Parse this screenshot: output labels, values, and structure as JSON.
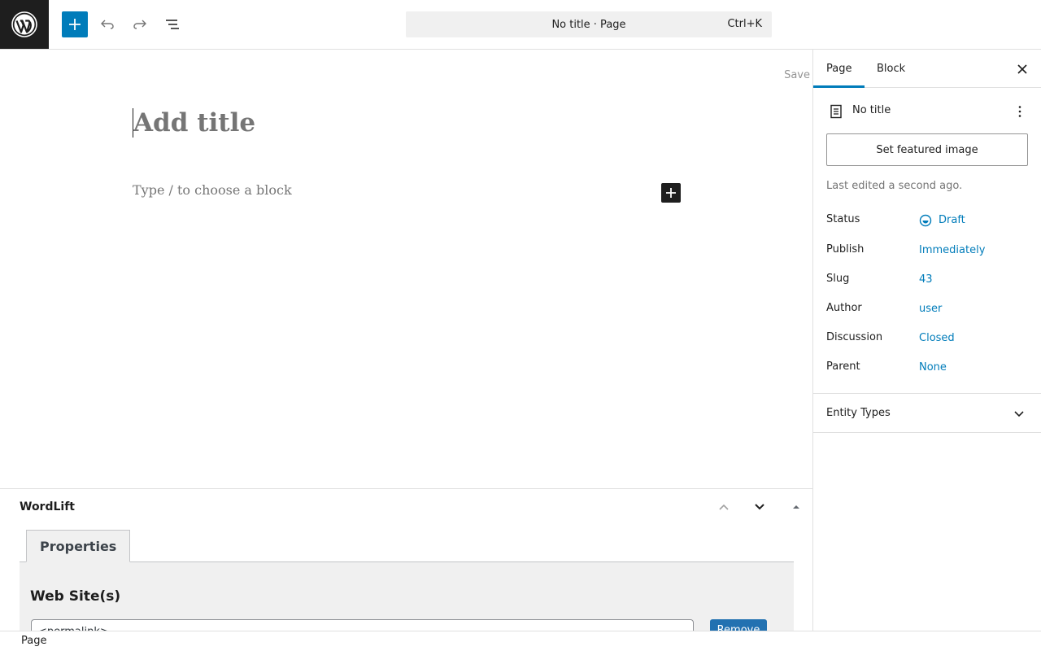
{
  "topbar": {
    "command_bar_label": "No title · Page",
    "command_bar_shortcut": "Ctrl+K"
  },
  "editor": {
    "save_label": "Save",
    "title_placeholder": "Add title",
    "block_placeholder": "Type / to choose a block"
  },
  "metabox": {
    "title": "WordLift",
    "tab_label": "Properties",
    "section_heading": "Web Site(s)",
    "input_value": "<permalink>",
    "remove_label": "Remove"
  },
  "footer": {
    "breadcrumb": "Page"
  },
  "sidebar": {
    "tabs": [
      {
        "label": "Page"
      },
      {
        "label": "Block"
      }
    ],
    "doc_title": "No title",
    "featured_image_label": "Set featured image",
    "last_edited": "Last edited a second ago.",
    "rows": [
      {
        "label": "Status",
        "value": "Draft"
      },
      {
        "label": "Publish",
        "value": "Immediately"
      },
      {
        "label": "Slug",
        "value": "43"
      },
      {
        "label": "Author",
        "value": "user"
      },
      {
        "label": "Discussion",
        "value": "Closed"
      },
      {
        "label": "Parent",
        "value": "None"
      }
    ],
    "entity_types_label": "Entity Types"
  },
  "colors": {
    "accent": "#007cba",
    "dark": "#1e1e1e",
    "remove_button": "#2271b1"
  },
  "icons": [
    "wordpress-logo-icon",
    "plus-icon",
    "undo-icon",
    "redo-icon",
    "document-overview-icon",
    "close-icon",
    "page-icon",
    "more-vertical-icon",
    "draft-status-icon",
    "chevron-up-icon",
    "chevron-down-icon",
    "triangle-up-icon"
  ]
}
